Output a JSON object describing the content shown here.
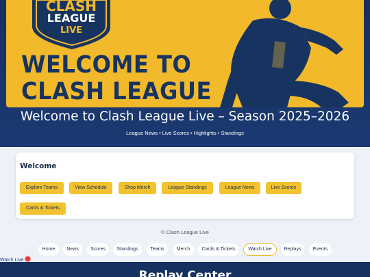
{
  "banner": {
    "logo_line1": "CLASH",
    "logo_line2": "LEAGUE",
    "logo_line3": "LIVE",
    "headline_line1": "WELCOME TO",
    "headline_line2": "CLASH LEAGUE"
  },
  "hero": {
    "title": "Welcome to Clash League Live – Season 2025–2026",
    "subtitle": "League News • Live Scores • Highlights • Standings"
  },
  "welcome": {
    "heading": "Welcome",
    "buttons": [
      "Explore Teams",
      "View Schedule",
      "Shop Merch",
      "League Standings",
      "League News",
      "Live Scores",
      "Cards & Tickets"
    ]
  },
  "footer": {
    "copyright": "© Clash League Live"
  },
  "nav": {
    "items": [
      "Home",
      "News",
      "Scores",
      "Standings",
      "Teams",
      "Merch",
      "Cards & Tickets",
      "Watch Live",
      "Replays",
      "Events"
    ],
    "active": "Watch Live"
  },
  "watch_live_link": "Watch Live",
  "replay": {
    "title": "Replay Center"
  },
  "colors": {
    "accent": "#f2b92b",
    "navy": "#16305f",
    "live": "#e23b3b"
  }
}
